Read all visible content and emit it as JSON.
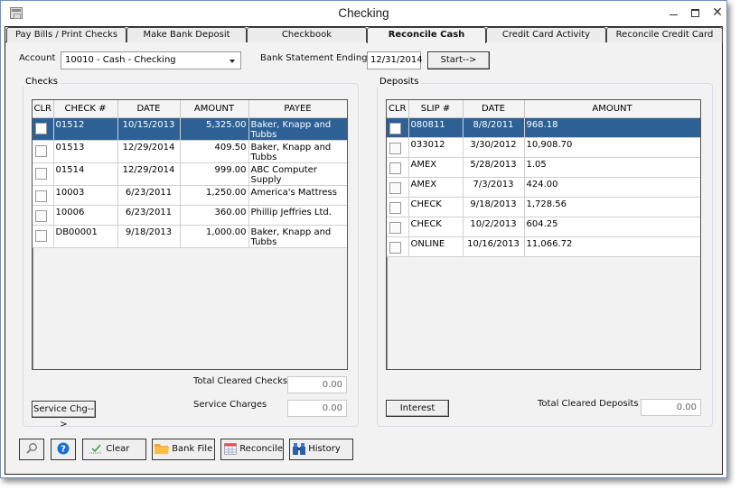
{
  "window": {
    "title": "Checking",
    "app_icon": "window-app-icon",
    "controls": {
      "minimize": "minimize-icon",
      "maximize": "maximize-icon",
      "close": "close-icon",
      "close_glyph": "✕"
    }
  },
  "tabs": [
    {
      "label": "Pay Bills / Print Checks",
      "active": false
    },
    {
      "label": "Make Bank Deposit",
      "active": false
    },
    {
      "label": "Checkbook",
      "active": false
    },
    {
      "label": "Reconcile Cash",
      "active": true
    },
    {
      "label": "Credit Card Activity",
      "active": false
    },
    {
      "label": "Reconcile Credit Card",
      "active": false
    }
  ],
  "header": {
    "account_label": "Account",
    "account_value": "10010 - Cash - Checking",
    "statement_label": "Bank Statement Ending",
    "statement_date": "12/31/2014",
    "start_button": "Start-->"
  },
  "checks": {
    "group_title": "Checks",
    "columns": [
      "CLR",
      "CHECK #",
      "DATE",
      "AMOUNT",
      "PAYEE"
    ],
    "rows": [
      {
        "clr": false,
        "check_no": "01512",
        "date": "10/15/2013",
        "amount": "5,325.00",
        "payee": "Baker, Knapp and Tubbs",
        "selected": true
      },
      {
        "clr": false,
        "check_no": "01513",
        "date": "12/29/2014",
        "amount": "409.50",
        "payee": "Baker, Knapp and Tubbs",
        "selected": false
      },
      {
        "clr": false,
        "check_no": "01514",
        "date": "12/29/2014",
        "amount": "999.00",
        "payee": "ABC Computer Supply",
        "selected": false
      },
      {
        "clr": false,
        "check_no": "10003",
        "date": "6/23/2011",
        "amount": "1,250.00",
        "payee": "America's Mattress",
        "selected": false
      },
      {
        "clr": false,
        "check_no": "10006",
        "date": "6/23/2011",
        "amount": "360.00",
        "payee": "Phillip Jeffries Ltd.",
        "selected": false
      },
      {
        "clr": false,
        "check_no": "DB00001",
        "date": "9/18/2013",
        "amount": "1,000.00",
        "payee": "Baker, Knapp and Tubbs",
        "selected": false
      }
    ],
    "total_cleared_label": "Total Cleared Checks",
    "total_cleared_value": "0.00",
    "service_charges_label": "Service Charges",
    "service_charges_value": "0.00",
    "service_button": "Service Chg-->"
  },
  "deposits": {
    "group_title": "Deposits",
    "columns": [
      "CLR",
      "SLIP #",
      "DATE",
      "AMOUNT"
    ],
    "rows": [
      {
        "clr": false,
        "slip_no": "080811",
        "date": "8/8/2011",
        "amount": "968.18",
        "selected": true
      },
      {
        "clr": false,
        "slip_no": "033012",
        "date": "3/30/2012",
        "amount": "10,908.70",
        "selected": false
      },
      {
        "clr": false,
        "slip_no": "AMEX",
        "date": "5/28/2013",
        "amount": "1.05",
        "selected": false
      },
      {
        "clr": false,
        "slip_no": "AMEX",
        "date": "7/3/2013",
        "amount": "424.00",
        "selected": false
      },
      {
        "clr": false,
        "slip_no": "CHECK",
        "date": "9/18/2013",
        "amount": "1,728.56",
        "selected": false
      },
      {
        "clr": false,
        "slip_no": "CHECK",
        "date": "10/2/2013",
        "amount": "604.25",
        "selected": false
      },
      {
        "clr": false,
        "slip_no": "ONLINE",
        "date": "10/16/2013",
        "amount": "11,066.72",
        "selected": false
      }
    ],
    "interest_button": "Interest",
    "total_cleared_label": "Total Cleared Deposits",
    "total_cleared_value": "0.00"
  },
  "toolbar": {
    "search_icon": "magnifier-icon",
    "help_icon": "help-icon",
    "clear_label": "Clear",
    "bank_file_label": "Bank File",
    "reconcile_label": "Reconcile",
    "history_label": "History"
  },
  "colors": {
    "selection": "#2d6196",
    "help_blue": "#1a6fd0",
    "folder": "#f5a623",
    "check_green": "#2a9a3a"
  }
}
